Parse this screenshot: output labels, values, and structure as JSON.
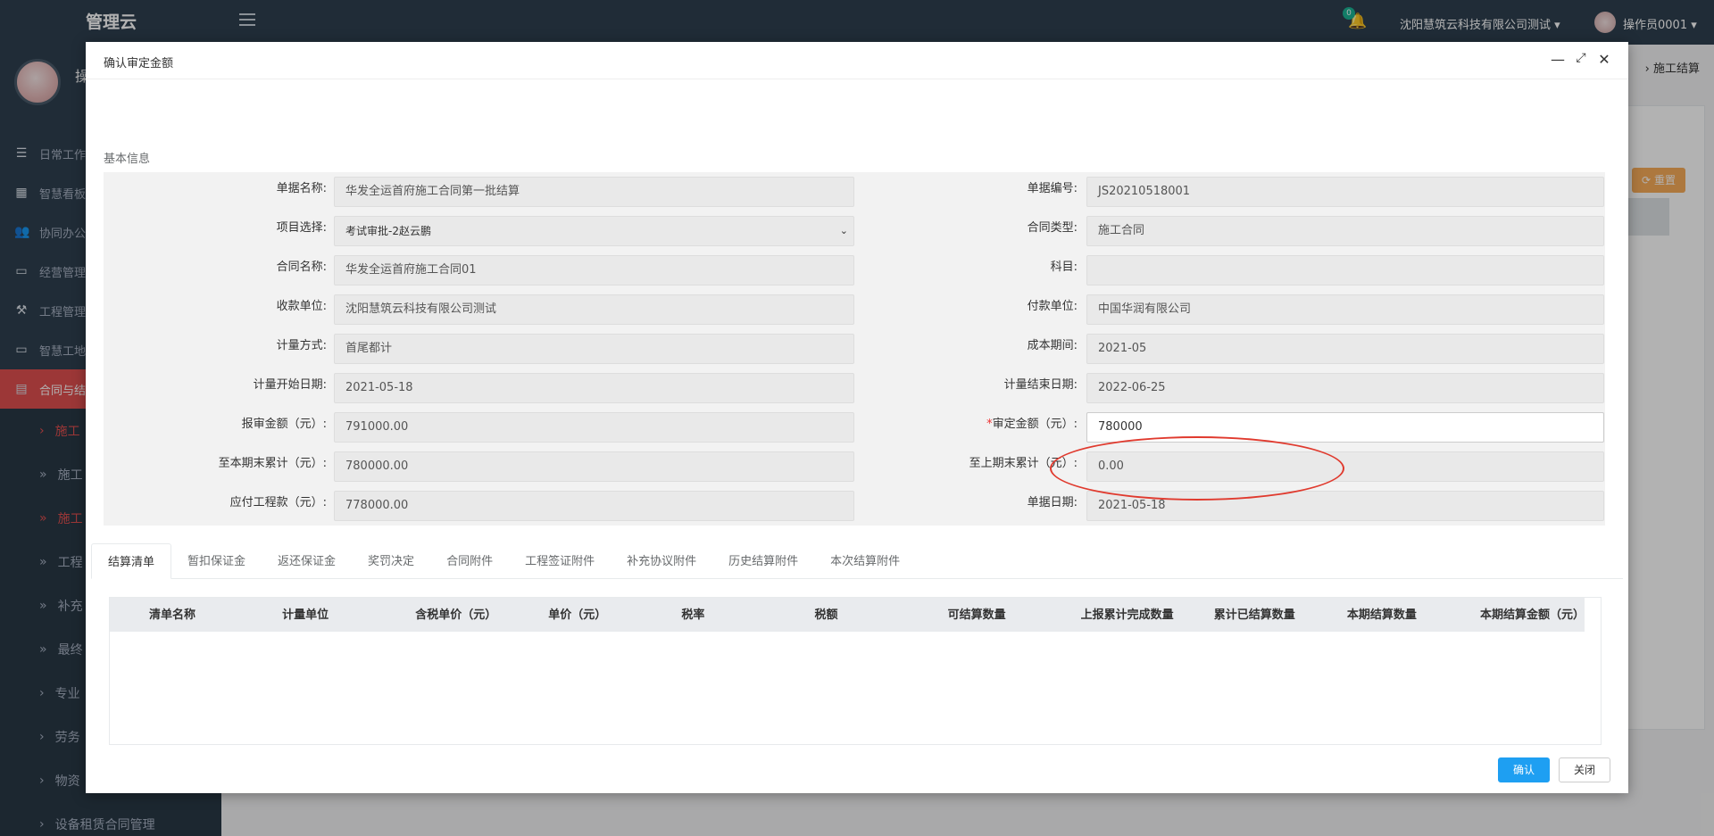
{
  "app": {
    "brand": "管理云",
    "user_short": "操"
  },
  "sidebar": {
    "items": [
      {
        "label": "日常工作",
        "icon": "list-icon"
      },
      {
        "label": "智慧看板",
        "icon": "dashboard-icon"
      },
      {
        "label": "协同办公",
        "icon": "users-icon"
      },
      {
        "label": "经营管理",
        "icon": "monitor-icon"
      },
      {
        "label": "工程管理",
        "icon": "hammer-icon"
      },
      {
        "label": "智慧工地",
        "icon": "monitor-icon"
      },
      {
        "label": "合同与结",
        "icon": "file-icon"
      }
    ],
    "subitems": [
      {
        "label": "施工",
        "marker": "›"
      },
      {
        "label": "施工",
        "marker": "»"
      },
      {
        "label": "施工",
        "marker": "»"
      },
      {
        "label": "工程",
        "marker": "»"
      },
      {
        "label": "补充",
        "marker": "»"
      },
      {
        "label": "最终",
        "marker": "»"
      },
      {
        "label": "专业",
        "marker": "›"
      },
      {
        "label": "劳务",
        "marker": "›"
      },
      {
        "label": "物资",
        "marker": "›"
      },
      {
        "label": "设备租赁合同管理",
        "marker": "›"
      }
    ]
  },
  "topbar": {
    "notifications": "0",
    "company": "沈阳慧筑云科技有限公司测试",
    "user": "操作员0001"
  },
  "background": {
    "breadcrumb_last": "施工结算",
    "reset_label": "重置"
  },
  "modal": {
    "title": "确认审定金额",
    "section_title": "基本信息",
    "left_fields": [
      {
        "label": "单据名称:",
        "value": "华发全运首府施工合同第一批结算"
      },
      {
        "label": "项目选择:",
        "value": "考试审批-2赵云鹏"
      },
      {
        "label": "合同名称:",
        "value": "华发全运首府施工合同01"
      },
      {
        "label": "收款单位:",
        "value": "沈阳慧筑云科技有限公司测试"
      },
      {
        "label": "计量方式:",
        "value": "首尾都计"
      },
      {
        "label": "计量开始日期:",
        "value": "2021-05-18"
      },
      {
        "label": "报审金额（元）:",
        "value": "791000.00"
      },
      {
        "label": "至本期末累计（元）:",
        "value": "780000.00"
      },
      {
        "label": "应付工程款（元）:",
        "value": "778000.00"
      }
    ],
    "right_fields": [
      {
        "label": "单据编号:",
        "value": "JS20210518001"
      },
      {
        "label": "合同类型:",
        "value": "施工合同"
      },
      {
        "label": "科目:",
        "value": ""
      },
      {
        "label": "付款单位:",
        "value": "中国华润有限公司"
      },
      {
        "label": "成本期间:",
        "value": "2021-05"
      },
      {
        "label": "计量结束日期:",
        "value": "2022-06-25"
      },
      {
        "label": "审定金额（元）:",
        "value": "780000",
        "required": "*"
      },
      {
        "label": "至上期末累计（元）:",
        "value": "0.00"
      },
      {
        "label": "单据日期:",
        "value": "2021-05-18"
      }
    ],
    "tabs": [
      "结算清单",
      "暂扣保证金",
      "返还保证金",
      "奖罚决定",
      "合同附件",
      "工程签证附件",
      "补充协议附件",
      "历史结算附件",
      "本次结算附件"
    ],
    "grid_columns": [
      "清单名称",
      "计量单位",
      "含税单价（元）",
      "单价（元）",
      "税率",
      "税额",
      "可结算数量",
      "上报累计完成数量",
      "累计已结算数量",
      "本期结算数量",
      "本期结算金额（元）"
    ],
    "buttons": {
      "confirm": "确认",
      "close": "关闭"
    }
  }
}
